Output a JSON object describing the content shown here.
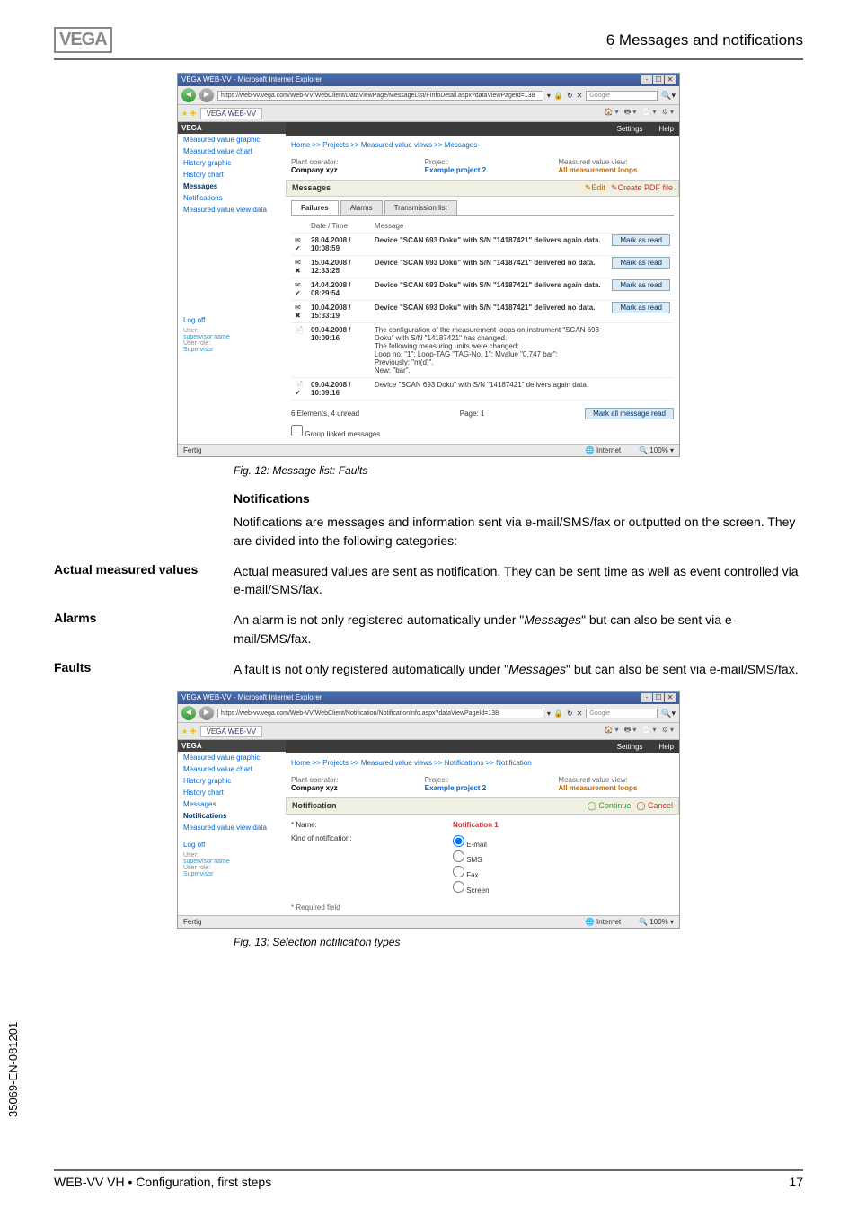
{
  "header": {
    "brand": "VEGA",
    "chapter": "6  Messages and notifications"
  },
  "screenshot1": {
    "window_title": "VEGA WEB-VV - Microsoft Internet Explorer",
    "url": "https://web-vv.vega.com/Web-VV/WebClient/DataViewPage/MessageList/FInfoDetail.aspx?dataViewPageId=138",
    "search_placeholder": "Google",
    "tab_label": "VEGA WEB-VV",
    "top_right_tools": "🏠 ▪ 🖶 ▪ 📄 ▪ ⚙ ▪",
    "settings": "Settings",
    "help": "Help",
    "breadcrumb": "Home >> Projects >> Measured value views >> Messages",
    "sidebar": {
      "items": [
        "Measured value graphic",
        "Measured value chart",
        "History graphic",
        "History chart",
        "Messages",
        "Notifications",
        "Measured value view data"
      ],
      "logoff": "Log off",
      "user_lbl": "User:",
      "user_val": "supervisor name",
      "role_lbl": "User role:",
      "role_val": "Supervisor"
    },
    "info": {
      "op_lbl": "Plant operator:",
      "op_val": "Company xyz",
      "proj_lbl": "Project:",
      "proj_val": "Example project 2",
      "view_lbl": "Measured value view:",
      "view_val": "All measurement loops"
    },
    "section": {
      "title": "Messages",
      "edit": "Edit",
      "pdf": "Create PDF file"
    },
    "tabs": [
      "Failures",
      "Alarms",
      "Transmission list"
    ],
    "cols": {
      "date": "Date / Time",
      "msg": "Message"
    },
    "rows": [
      {
        "icon": "✉ ✔",
        "dt": "28.04.2008 / 10:08:59",
        "msg": "Device \"SCAN 693 Doku\" with S/N \"14187421\" delivers again data.",
        "mark": "Mark as read"
      },
      {
        "icon": "✉ ✖",
        "dt": "15.04.2008 / 12:33:25",
        "msg": "Device \"SCAN 693 Doku\" with S/N \"14187421\" delivered no data.",
        "mark": "Mark as read"
      },
      {
        "icon": "✉ ✔",
        "dt": "14.04.2008 / 08:29:54",
        "msg": "Device \"SCAN 693 Doku\" with S/N \"14187421\" delivers again data.",
        "mark": "Mark as read"
      },
      {
        "icon": "✉ ✖",
        "dt": "10.04.2008 / 15:33:19",
        "msg": "Device \"SCAN 693 Doku\" with S/N \"14187421\" delivered no data.",
        "mark": "Mark as read"
      },
      {
        "icon": "📄",
        "dt": "09.04.2008 / 10:09:16",
        "msg": "The configuration of the measurement loops on instrument \"SCAN 693 Doku\" with S/N \"14187421\" has changed.\nThe following measuring units were changed:\nLoop no. \"1\"; Loop-TAG \"TAG-No. 1\"; Mvalue \"0,747 bar\":\nPreviously: \"m(d)\".\nNew: \"bar\".",
        "mark": ""
      },
      {
        "icon": "📄 ✔",
        "dt": "09.04.2008 / 10:09:16",
        "msg": "Device \"SCAN 693 Doku\" with S/N \"14187421\" delivers again data.",
        "mark": ""
      }
    ],
    "pager": {
      "summary": "6 Elements, 4 unread",
      "page": "Page: 1",
      "mark_all": "Mark all message read"
    },
    "group_linked": "Group linked messages",
    "status_done": "Fertig",
    "status_zone": "Internet",
    "status_zoom": "100%"
  },
  "fig12": "Fig. 12: Message list: Faults",
  "notif_section": {
    "heading": "Notifications",
    "para": "Notifications are messages and information sent via e-mail/SMS/fax or outputted on the screen. They are divided into the following categories:"
  },
  "amv": {
    "label": "Actual measured values",
    "text": "Actual measured values are sent as notification. They can be sent time as well as event controlled via e-mail/SMS/fax."
  },
  "alarms": {
    "label": "Alarms",
    "text_a": "An alarm is not only registered automatically under \"",
    "text_i": "Messages",
    "text_b": "\" but can also be sent via e-mail/SMS/fax."
  },
  "faults": {
    "label": "Faults",
    "text_a": "A fault is not only registered automatically under \"",
    "text_i": "Messages",
    "text_b": "\" but can also be sent via e-mail/SMS/fax."
  },
  "screenshot2": {
    "window_title": "VEGA WEB-VV - Microsoft Internet Explorer",
    "url": "https://web-vv.vega.com/Web-VV/WebClient/Notification/NotificationInfo.aspx?dataViewPageId=138",
    "search_placeholder": "Google",
    "tab_label": "VEGA WEB-VV",
    "breadcrumb": "Home >> Projects >> Measured value views >> Notifications >> Notification",
    "sidebar": {
      "items": [
        "Measured value graphic",
        "Measured value chart",
        "History graphic",
        "History chart",
        "Messages",
        "Notifications",
        "Measured value view data"
      ],
      "logoff": "Log off",
      "user_lbl": "User:",
      "user_val": "supervisor name",
      "role_lbl": "User role:",
      "role_val": "Supervisor"
    },
    "info": {
      "op_lbl": "Plant operator:",
      "op_val": "Company xyz",
      "proj_lbl": "Project:",
      "proj_val": "Example project 2",
      "view_lbl": "Measured value view:",
      "view_val": "All measurement loops"
    },
    "section": {
      "title": "Notification",
      "continue": "Continue",
      "cancel": "Cancel"
    },
    "form": {
      "name_lbl": "* Name:",
      "name_val": "Notification 1",
      "kind_lbl": "Kind of notification:",
      "opts": [
        "E-mail",
        "SMS",
        "Fax",
        "Screen"
      ],
      "req": "* Required field"
    },
    "settings": "Settings",
    "help": "Help",
    "status_done": "Fertig",
    "status_zone": "Internet",
    "status_zoom": "100%"
  },
  "fig13": "Fig. 13: Selection notification types",
  "docnum": "35069-EN-081201",
  "footer": {
    "left": "WEB-VV VH • Configuration, first steps",
    "right": "17"
  }
}
